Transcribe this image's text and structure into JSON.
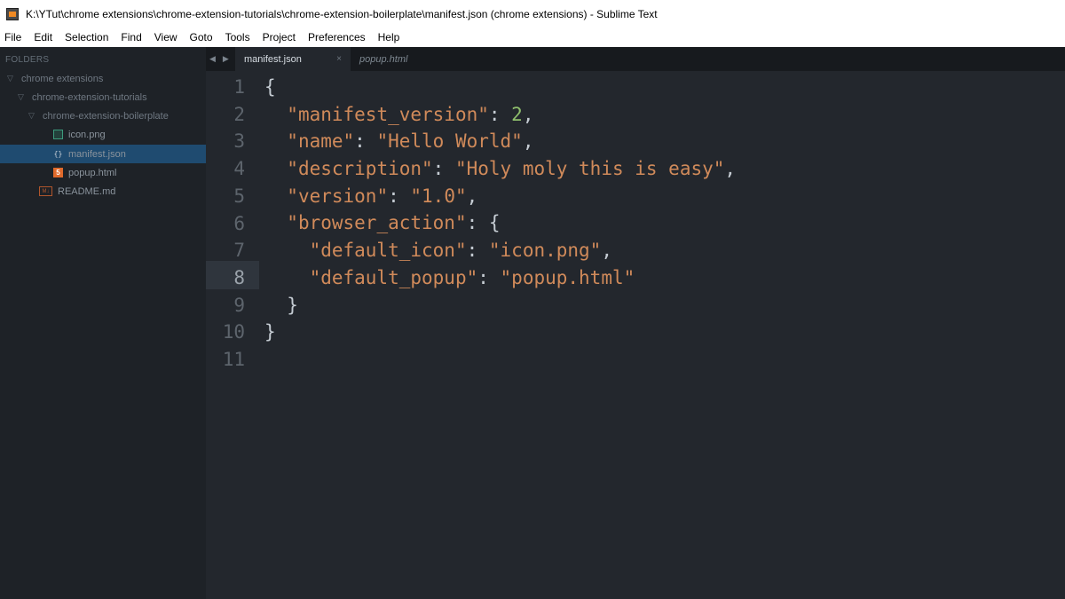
{
  "window": {
    "title": "K:\\YTut\\chrome extensions\\chrome-extension-tutorials\\chrome-extension-boilerplate\\manifest.json (chrome extensions) - Sublime Text"
  },
  "menu": [
    "File",
    "Edit",
    "Selection",
    "Find",
    "View",
    "Goto",
    "Tools",
    "Project",
    "Preferences",
    "Help"
  ],
  "sidebar": {
    "header": "FOLDERS",
    "items": [
      {
        "label": "chrome extensions",
        "type": "folder",
        "icon": "chevron-down-icon"
      },
      {
        "label": "chrome-extension-tutorials",
        "type": "folder",
        "icon": "chevron-down-icon"
      },
      {
        "label": "chrome-extension-boilerplate",
        "type": "folder",
        "icon": "chevron-down-icon"
      },
      {
        "label": "icon.png",
        "type": "file",
        "icon": "image-file-icon"
      },
      {
        "label": "manifest.json",
        "type": "file",
        "icon": "json-file-icon",
        "selected": true
      },
      {
        "label": "popup.html",
        "type": "file",
        "icon": "html5-file-icon"
      },
      {
        "label": "README.md",
        "type": "file",
        "icon": "markdown-file-icon"
      }
    ]
  },
  "tabs": {
    "nav_left": "◀",
    "nav_right": "▶",
    "active": {
      "label": "manifest.json",
      "close": "×"
    },
    "inactive": {
      "label": "popup.html"
    }
  },
  "editor": {
    "line_numbers": [
      "1",
      "2",
      "3",
      "4",
      "5",
      "6",
      "7",
      "8",
      "9",
      "10",
      "11"
    ],
    "current_line": 8,
    "lines": [
      "{",
      "  \"manifest_version\": 2,",
      "  \"name\": \"Hello World\",",
      "  \"description\": \"Holy moly this is easy\",",
      "  \"version\": \"1.0\",",
      "  \"browser_action\": {",
      "    \"default_icon\": \"icon.png\",",
      "    \"default_popup\": \"popup.html\"",
      "  }",
      "}",
      ""
    ]
  },
  "colors": {
    "string": "#d08a5a",
    "number": "#8fbf6c",
    "selection": "#1f4b70",
    "background": "#23272d"
  }
}
